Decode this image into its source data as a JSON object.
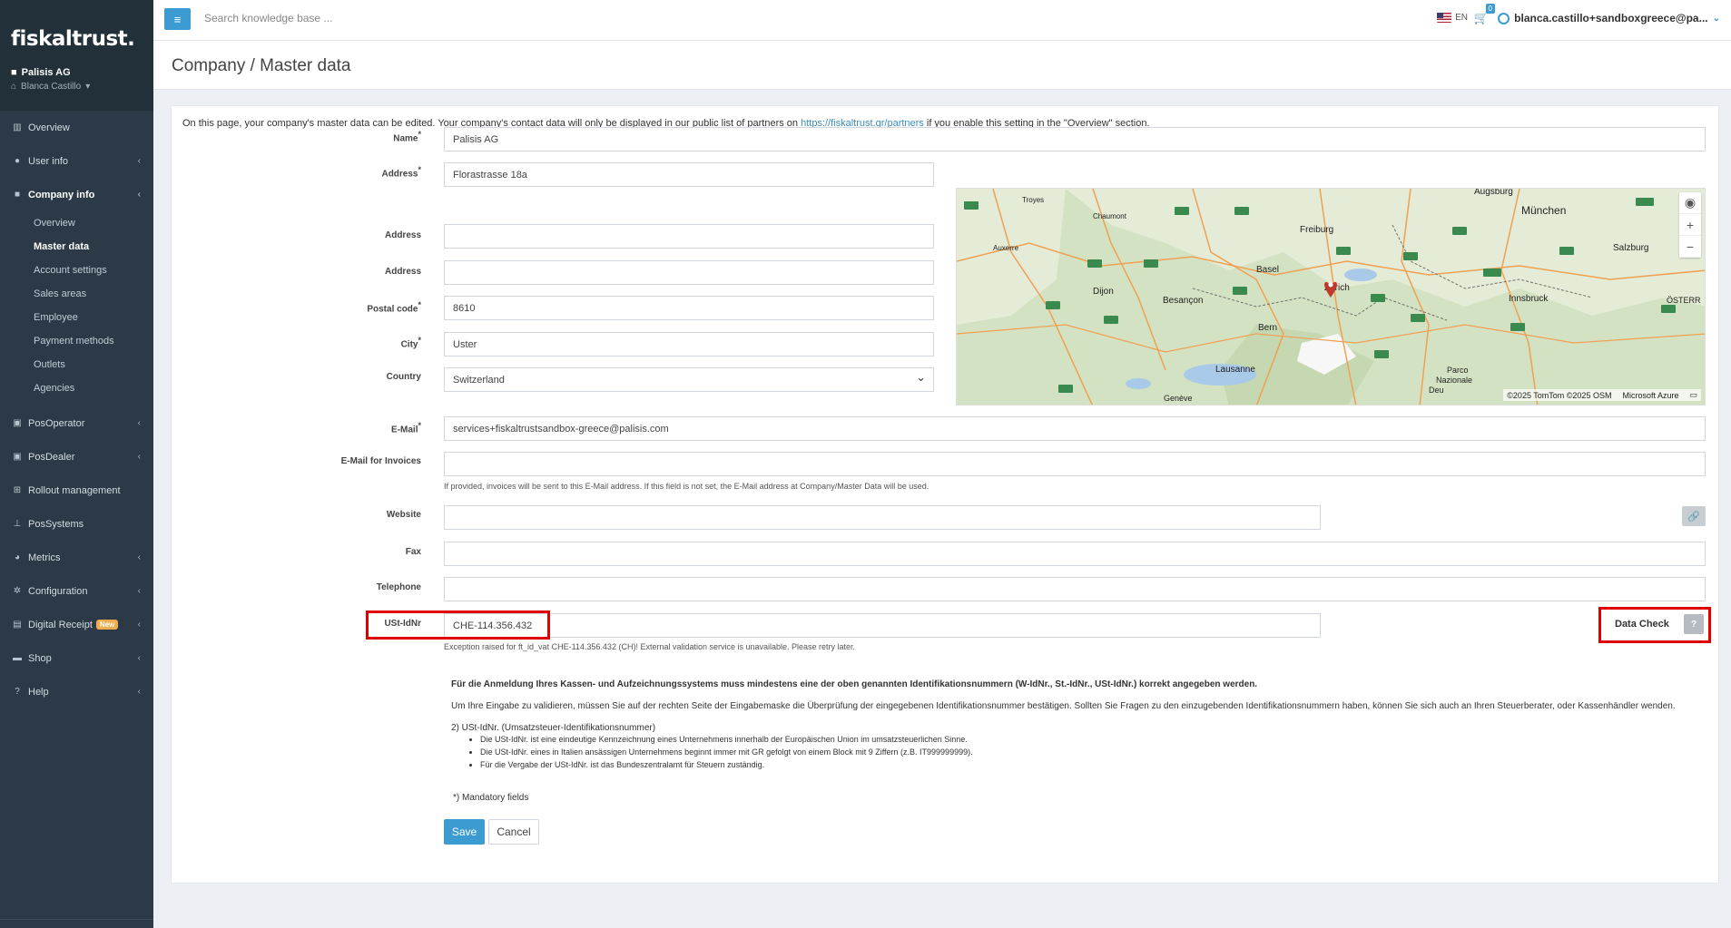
{
  "brand": {
    "logo": "fiskaltrust.",
    "company": "Palisis AG",
    "user": "Blanca Castillo"
  },
  "topbar": {
    "search_placeholder": "Search knowledge base ...",
    "language": "EN",
    "cart_count": "0",
    "account": "blanca.castillo+sandboxgreece@pa..."
  },
  "sidebar": {
    "items": [
      {
        "label": "Overview",
        "icon": "chart-icon"
      },
      {
        "label": "User info",
        "icon": "user-icon"
      },
      {
        "label": "Company info",
        "icon": "briefcase-icon"
      },
      {
        "label": "PosOperator",
        "icon": "store-icon"
      },
      {
        "label": "PosDealer",
        "icon": "store-icon"
      },
      {
        "label": "Rollout management",
        "icon": "plus-square-icon"
      },
      {
        "label": "PosSystems",
        "icon": "sitemap-icon"
      },
      {
        "label": "Metrics",
        "icon": "pie-icon"
      },
      {
        "label": "Configuration",
        "icon": "cogs-icon"
      },
      {
        "label": "Digital Receipt",
        "icon": "receipt-icon",
        "badge": "New"
      },
      {
        "label": "Shop",
        "icon": "card-icon"
      },
      {
        "label": "Help",
        "icon": "help-icon"
      }
    ],
    "company_sub": [
      "Overview",
      "Master data",
      "Account settings",
      "Sales areas",
      "Employee",
      "Payment methods",
      "Outlets",
      "Agencies"
    ]
  },
  "page": {
    "title": "Company / Master data",
    "info_before": "On this page, your company's master data can be edited. Your company's contact data will only be displayed in our public list of partners on ",
    "info_link": "https://fiskaltrust.gr/partners",
    "info_after": " if you enable this setting in the \"Overview\" section."
  },
  "form": {
    "name_label": "Name",
    "name_value": "Palisis AG",
    "address1_label": "Address",
    "address1_value": "Florastrasse 18a",
    "address2_label": "Address",
    "address2_value": "",
    "address3_label": "Address",
    "address3_value": "",
    "postal_label": "Postal code",
    "postal_value": "8610",
    "city_label": "City",
    "city_value": "Uster",
    "country_label": "Country",
    "country_value": "Switzerland",
    "email_label": "E-Mail",
    "email_value": "services+fiskaltrustsandbox-greece@palisis.com",
    "invoice_email_label": "E-Mail for Invoices",
    "invoice_email_value": "",
    "invoice_help": "If provided, invoices will be sent to this E-Mail address. If this field is not set, the E-Mail address at Company/Master Data will be used.",
    "website_label": "Website",
    "website_value": "",
    "fax_label": "Fax",
    "fax_value": "",
    "telephone_label": "Telephone",
    "telephone_value": "",
    "vat_label": "USt-IdNr",
    "vat_value": "CHE-114.356.432",
    "vat_error": "Exception raised for ft_id_vat CHE-114.356.432 (CH)! External validation service is unavailable. Please retry later.",
    "data_check_label": "Data Check",
    "data_check_btn": "?"
  },
  "map": {
    "cities": [
      "Augsburg",
      "München",
      "Salzburg",
      "Troyes",
      "Chaumont",
      "Freiburg",
      "Auxerre",
      "Basel",
      "Zürich",
      "Dijon",
      "Besançon",
      "Innsbruck",
      "ÖSTERR",
      "Bern",
      "Lausanne",
      "Genève",
      "Parco Nazionale",
      "Deu"
    ],
    "attribution": "©2025 TomTom ©2025 OSM",
    "provider": "Microsoft Azure"
  },
  "notes": {
    "p1": "Für die Anmeldung Ihres Kassen- und Aufzeichnungssystems muss mindestens eine der oben genannten Identifikationsnummern (W-IdNr., St.-IdNr., USt-IdNr.) korrekt angegeben werden.",
    "p2": "Um Ihre Eingabe zu validieren, müssen Sie auf der rechten Seite der Eingabemaske die Überprüfung der eingegebenen Identifikationsnummer bestätigen. Sollten Sie Fragen zu den einzugebenden Identifikationsnummern haben, können Sie sich auch an Ihren Steuerberater, oder Kassenhändler wenden.",
    "p3": "2) USt-IdNr. (Umsatzsteuer-Identifikationsnummer)",
    "bullets": [
      "Die USt-IdNr. ist eine eindeutige Kennzeichnung eines Unternehmens innerhalb der Europäischen Union im umsatzsteuerlichen Sinne.",
      "Die USt-IdNr. eines in Italien ansässigen Unternehmens beginnt immer mit GR gefolgt von einem Block mit 9 Ziffern (z.B. IT999999999).",
      "Für die Vergabe der USt-IdNr. ist das Bundeszentralamt für Steuern zuständig."
    ],
    "mandatory": "*) Mandatory fields"
  },
  "buttons": {
    "save": "Save",
    "cancel": "Cancel"
  },
  "colors": {
    "accent": "#3c9bd1",
    "sidebar": "#2b3a46",
    "highlight": "#e00000"
  }
}
